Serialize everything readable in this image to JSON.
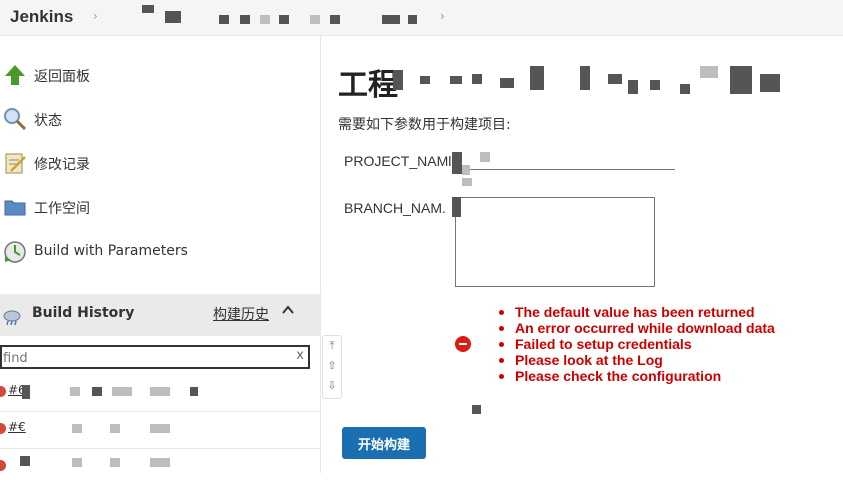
{
  "header": {
    "brand": "Jenkins"
  },
  "sidebar": {
    "tasks": [
      {
        "label": "返回面板",
        "icon": "up-arrow-icon"
      },
      {
        "label": "状态",
        "icon": "search-icon"
      },
      {
        "label": "修改记录",
        "icon": "notepad-icon"
      },
      {
        "label": "工作空间",
        "icon": "folder-icon"
      },
      {
        "label": "Build with Parameters",
        "icon": "clock-icon"
      }
    ],
    "build_history": {
      "label": "Build History",
      "link": "构建历史",
      "caret": "^"
    },
    "find": {
      "placeholder": "find",
      "clear": "x"
    },
    "builds": [
      {
        "num": "#6"
      },
      {
        "num": "#€"
      }
    ]
  },
  "main": {
    "title": "工程",
    "description": "需要如下参数用于构建项目:",
    "params": [
      {
        "name": "PROJECT_NAMl"
      },
      {
        "name": "BRANCH_NAM."
      }
    ],
    "errors": [
      "The default value has been returned",
      "An error occurred while download data",
      "Failed to setup credentials",
      "Please look at the Log",
      "Please check the configuration"
    ],
    "submit_label": "开始构建"
  },
  "colors": {
    "error": "#cc0000",
    "primary_button": "#1a6fb0",
    "header_bg": "#f5f5f5"
  }
}
